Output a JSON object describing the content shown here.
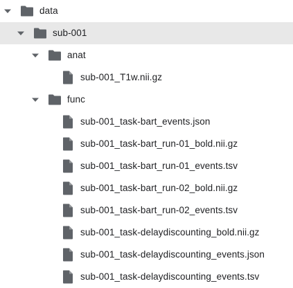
{
  "tree": {
    "root": {
      "label": "data",
      "expanded": true,
      "icon": "folder-icon"
    },
    "subject": {
      "label": "sub-001",
      "expanded": true,
      "selected": true,
      "icon": "folder-icon"
    },
    "anat": {
      "label": "anat",
      "expanded": true,
      "icon": "folder-icon"
    },
    "anat_files": [
      {
        "label": "sub-001_T1w.nii.gz",
        "icon": "file-icon"
      }
    ],
    "func": {
      "label": "func",
      "expanded": true,
      "icon": "folder-icon"
    },
    "func_files": [
      {
        "label": "sub-001_task-bart_events.json",
        "icon": "file-icon"
      },
      {
        "label": "sub-001_task-bart_run-01_bold.nii.gz",
        "icon": "file-icon"
      },
      {
        "label": "sub-001_task-bart_run-01_events.tsv",
        "icon": "file-icon"
      },
      {
        "label": "sub-001_task-bart_run-02_bold.nii.gz",
        "icon": "file-icon"
      },
      {
        "label": "sub-001_task-bart_run-02_events.tsv",
        "icon": "file-icon"
      },
      {
        "label": "sub-001_task-delaydiscounting_bold.nii.gz",
        "icon": "file-icon"
      },
      {
        "label": "sub-001_task-delaydiscounting_events.json",
        "icon": "file-icon"
      },
      {
        "label": "sub-001_task-delaydiscounting_events.tsv",
        "icon": "file-icon"
      }
    ]
  },
  "colors": {
    "icon": "#5f6368",
    "selected_row": "#e8e8e8",
    "text": "#202124"
  }
}
